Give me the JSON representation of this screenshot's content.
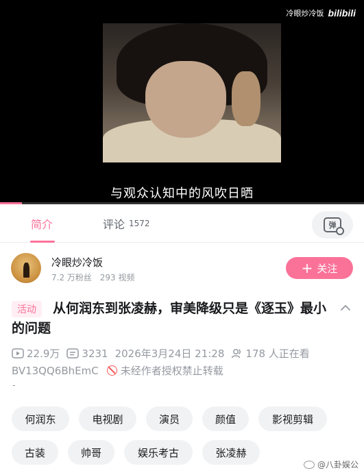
{
  "video": {
    "subtitle": "与观众认知中的风吹日晒",
    "watermark_channel": "冷眼炒冷饭",
    "watermark_brand": "bilibili",
    "progress_fraction": 0.06
  },
  "tabs": {
    "intro_label": "简介",
    "comments_label": "评论",
    "comments_count": "1572",
    "danmaku_glyph": "弹"
  },
  "uploader": {
    "name": "冷眼炒冷饭",
    "fans": "7.2 万粉丝",
    "videos": "293 视频",
    "follow_label": "关注",
    "follow_plus": "+"
  },
  "video_info": {
    "badge": "活动",
    "title": "从何润东到张凌赫，审美降级只是《逐玉》最小的问题",
    "views": "22.9万",
    "danmaku_count": "3231",
    "datetime": "2026年3月24日 21:28",
    "watching": "178 人正在看",
    "bvid": "BV13QQ6BhEmC",
    "copyright_notice": "未经作者授权禁止转载",
    "description": "-"
  },
  "tags": [
    "何润东",
    "电视剧",
    "演员",
    "颜值",
    "影视剪辑",
    "古装",
    "帅哥",
    "娱乐考古",
    "张凌赫"
  ],
  "footer": {
    "weibo_watermark": "@八卦娱公"
  },
  "colors": {
    "accent": "#fb7299",
    "muted": "#9499a0",
    "warning": "#f45a5a"
  }
}
